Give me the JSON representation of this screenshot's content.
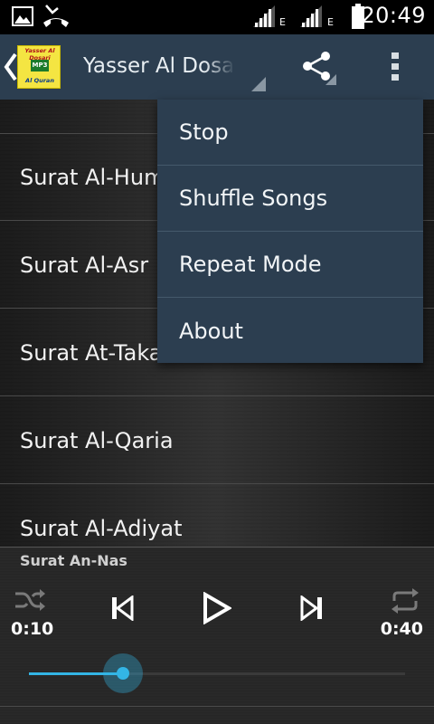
{
  "status_bar": {
    "time": "20:49",
    "icons": [
      "image-icon",
      "missed-call-icon",
      "signal-1-icon",
      "data-e-icon",
      "signal-2-icon",
      "data-e-icon",
      "battery-icon"
    ],
    "network_label": "E"
  },
  "action_bar": {
    "logo": {
      "line1": "Yasser Al Dosari",
      "line2": "MP3",
      "line3": "Al Quran"
    },
    "title": "Yasser Al Dosari",
    "actions": [
      "share-icon",
      "overflow-menu-icon"
    ]
  },
  "list": {
    "items": [
      {
        "label": "Surat Al-Humaza"
      },
      {
        "label": "Surat Al-Asr"
      },
      {
        "label": "Surat At-Takathur"
      },
      {
        "label": "Surat Al-Qaria"
      },
      {
        "label": "Surat Al-Adiyat"
      }
    ]
  },
  "menu": {
    "items": [
      {
        "label": "Stop"
      },
      {
        "label": "Shuffle Songs"
      },
      {
        "label": "Repeat Mode"
      },
      {
        "label": "About"
      }
    ]
  },
  "player": {
    "now_playing": "Surat An-Nas",
    "elapsed": "0:10",
    "duration": "0:40",
    "progress": 0.25,
    "controls": [
      "shuffle-icon",
      "previous-icon",
      "play-icon",
      "next-icon",
      "repeat-icon"
    ]
  },
  "colors": {
    "accent": "#33b5e5",
    "action_bar": "#2c3e50",
    "menu_bg": "#2c3e50"
  }
}
